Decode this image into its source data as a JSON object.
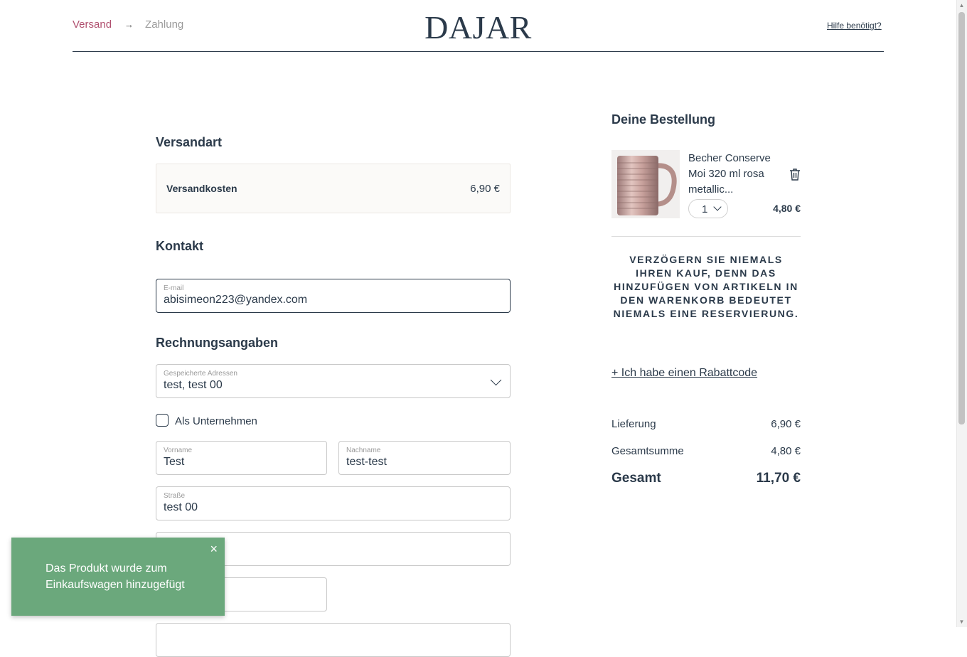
{
  "header": {
    "steps": [
      {
        "label": "Versand"
      },
      {
        "label": "Zahlung"
      }
    ],
    "step_arrow": "→",
    "logo": "DAJAR",
    "help_link": "Hilfe benötigt?"
  },
  "shipping": {
    "title": "Versandart",
    "label": "Versandkosten",
    "price": "6,90 €"
  },
  "contact": {
    "title": "Kontakt",
    "email_label": "E-mail",
    "email_value": "abisimeon223@yandex.com"
  },
  "billing": {
    "title": "Rechnungsangaben",
    "saved_addresses_label": "Gespeicherte Adressen",
    "saved_addresses_value": "test, test 00",
    "company_checkbox_label": "Als Unternehmen",
    "company_checked": false,
    "firstname_label": "Vorname",
    "firstname_value": "Test",
    "lastname_label": "Nachname",
    "lastname_value": "test-test",
    "street_label": "Straße",
    "street_value": "test 00"
  },
  "order": {
    "title": "Deine Bestellung",
    "item": {
      "name": "Becher Conserve Moi 320 ml rosa metallic...",
      "quantity": "1",
      "price": "4,80 €",
      "image": "pink-metallic-ribbed-mug"
    },
    "notice": "VERZÖGERN SIE NIEMALS IHREN KAUF, DENN DAS HINZUFÜGEN VON ARTIKELN IN DEN WARENKORB BEDEUTET NIEMALS EINE RESERVIERUNG.",
    "discount_link": "+ Ich habe einen Rabattcode",
    "delivery_label": "Lieferung",
    "delivery_value": "6,90 €",
    "subtotal_label": "Gesamtsumme",
    "subtotal_value": "4,80 €",
    "total_label": "Gesamt",
    "total_value": "11,70 €"
  },
  "toast": {
    "message": "Das Produkt wurde zum Einkaufswagen hinzugefügt",
    "close": "×"
  },
  "colors": {
    "accent": "#b0506f",
    "text": "#2b3a4a",
    "toast": "#6ba87c"
  }
}
